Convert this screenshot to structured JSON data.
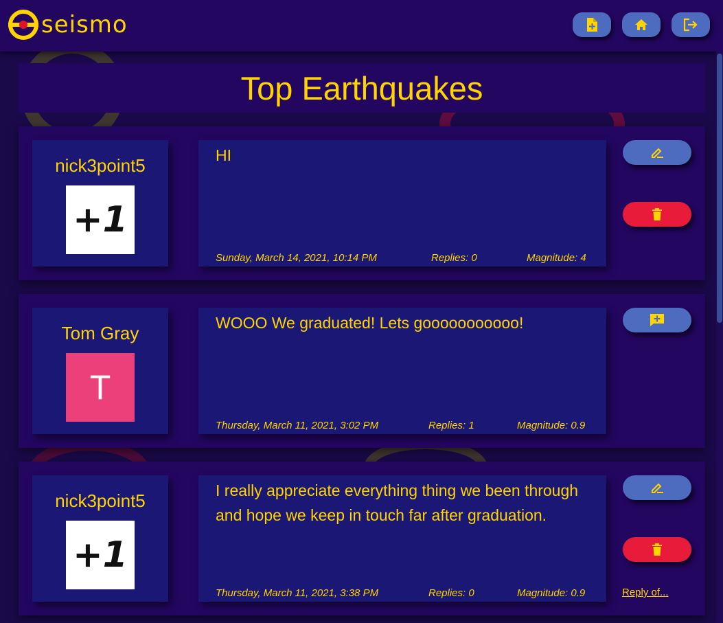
{
  "brand": {
    "name": "seismo"
  },
  "nav": {
    "buttons": [
      {
        "name": "new-post",
        "icon": "document-plus-icon"
      },
      {
        "name": "home",
        "icon": "home-icon"
      },
      {
        "name": "logout",
        "icon": "logout-icon"
      }
    ]
  },
  "page": {
    "title": "Top Earthquakes"
  },
  "posts": [
    {
      "user": "nick3point5",
      "avatar": "+1",
      "message": "HI",
      "date": "Sunday, March 14, 2021, 10:14 PM",
      "replies": "Replies: 0",
      "magnitude": "Magnitude: 4"
    },
    {
      "user": "Tom Gray",
      "avatar": "T",
      "message": "WOOO We graduated! Lets gooooooooooo!",
      "date": "Thursday, March 11, 2021, 3:02 PM",
      "replies": "Replies: 1",
      "magnitude": "Magnitude: 0.9"
    },
    {
      "user": "nick3point5",
      "avatar": "+1",
      "message": "I really appreciate everything thing we been through and hope we keep in touch far after graduation.",
      "date": "Thursday, March 11, 2021, 3:38 PM",
      "replies": "Replies: 0",
      "magnitude": "Magnitude: 0.9",
      "reply_link": "Reply of..."
    }
  ],
  "colors": {
    "accent": "#ffd400",
    "navbar": "#230660",
    "card": "#230660",
    "panel": "#1a1775",
    "button_blue": "#4e6cbf",
    "button_red": "#e81c3a",
    "avatar_pink": "#ec407a"
  }
}
